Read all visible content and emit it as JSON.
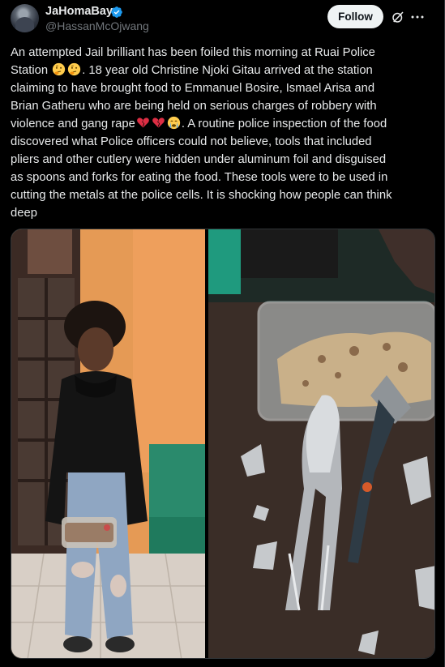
{
  "author": {
    "display_name": "JaHomaBay",
    "handle": "@HassanMcOjwang",
    "avatar_icon": "avatar-photo",
    "verified_icon": "verified-badge-icon",
    "verified_color": "#1d9bf0"
  },
  "actions": {
    "follow_label": "Follow",
    "grok_icon": "grok-icon",
    "more_icon": "more-icon"
  },
  "tweet": {
    "lines": [
      "An attempted Jail brilliant has been foiled this morning at Ruai Police",
      "Station",
      ". 18 year old Christine Njoki Gitau arrived at the station",
      "claiming to have brought food to Emmanuel Bosire, Ismael Arisa and",
      "Brian Gatheru who are being held on serious charges of robbery with",
      "violence and gang rape",
      ". A routine police inspection of the food",
      "discovered what Police officers could not believe, tools that included",
      "pliers and other cutlery were hidden under aluminum foil and disguised",
      "as spoons and forks for eating the food. These tools were to be used in",
      "cutting the metals at the police cells. It is shocking how people can think",
      "deep"
    ],
    "emojis": [
      "thinking-face-emoji",
      "thinking-face-emoji",
      "broken-heart-emoji",
      "broken-heart-emoji",
      "crying-face-emoji"
    ]
  },
  "media": {
    "left_image": "photo-young-woman-holding-food-container",
    "right_image": "photo-foil-wrapped-pliers-and-food-container"
  },
  "colors": {
    "background": "#000000",
    "text": "#e7e9ea",
    "secondary_text": "#71767b",
    "follow_bg": "#eff3f4"
  }
}
